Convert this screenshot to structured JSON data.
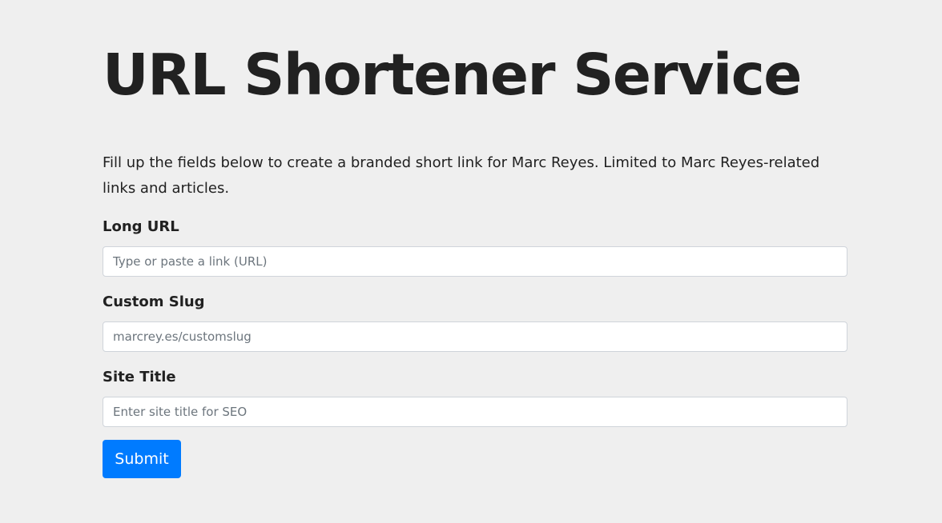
{
  "header": {
    "title": "URL Shortener Service"
  },
  "intro": {
    "text": "Fill up the fields below to create a branded short link for Marc Reyes. Limited to Marc Reyes-related links and articles."
  },
  "form": {
    "long_url": {
      "label": "Long URL",
      "placeholder": "Type or paste a link (URL)",
      "value": ""
    },
    "custom_slug": {
      "label": "Custom Slug",
      "placeholder": "marcrey.es/customslug",
      "value": ""
    },
    "site_title": {
      "label": "Site Title",
      "placeholder": "Enter site title for SEO",
      "value": ""
    },
    "submit_label": "Submit"
  },
  "colors": {
    "background": "#efefef",
    "text": "#212121",
    "primary": "#007bff",
    "input_border": "#cfd4da",
    "placeholder": "#6c757d"
  }
}
